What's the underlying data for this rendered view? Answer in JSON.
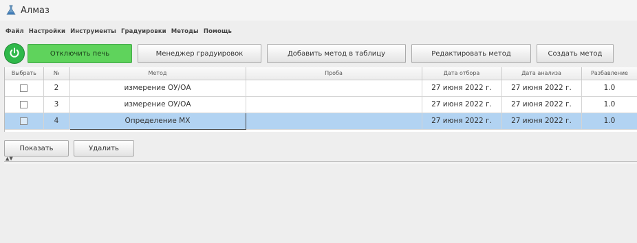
{
  "window": {
    "title": "Алмаз",
    "icon": "flask-icon"
  },
  "menu": [
    "Файл",
    "Настройки",
    "Инструменты",
    "Градуировки",
    "Методы",
    "Помощь"
  ],
  "toolbar": {
    "power_icon": "power-icon",
    "power_color": "#2fb84a",
    "buttons": [
      "Отключить печь",
      "Менеджер градуировок",
      "Добавить метод в таблицу",
      "Редактировать метод",
      "Создать метод"
    ]
  },
  "table": {
    "columns": [
      "Выбрать",
      "№",
      "Метод",
      "Проба",
      "Дата отбора",
      "Дата анализа",
      "Разбавление"
    ],
    "rows": [
      {
        "checked": false,
        "num": "2",
        "method": "измерение ОУ/ОА",
        "sample": "",
        "date_taken": "27 июня 2022 г.",
        "date_analysis": "27 июня 2022 г.",
        "dilution": "1.0",
        "selected": false
      },
      {
        "checked": false,
        "num": "3",
        "method": "измерение ОУ/ОА",
        "sample": "",
        "date_taken": "27 июня 2022 г.",
        "date_analysis": "27 июня 2022 г.",
        "dilution": "1.0",
        "selected": false
      },
      {
        "checked": false,
        "num": "4",
        "method": "Определение МХ",
        "sample": "",
        "date_taken": "27 июня 2022 г.",
        "date_analysis": "27 июня 2022 г.",
        "dilution": "1.0",
        "selected": true
      }
    ],
    "selection_color": "#b2d3f2"
  },
  "actions": {
    "show_label": "Показать",
    "delete_label": "Удалить"
  }
}
